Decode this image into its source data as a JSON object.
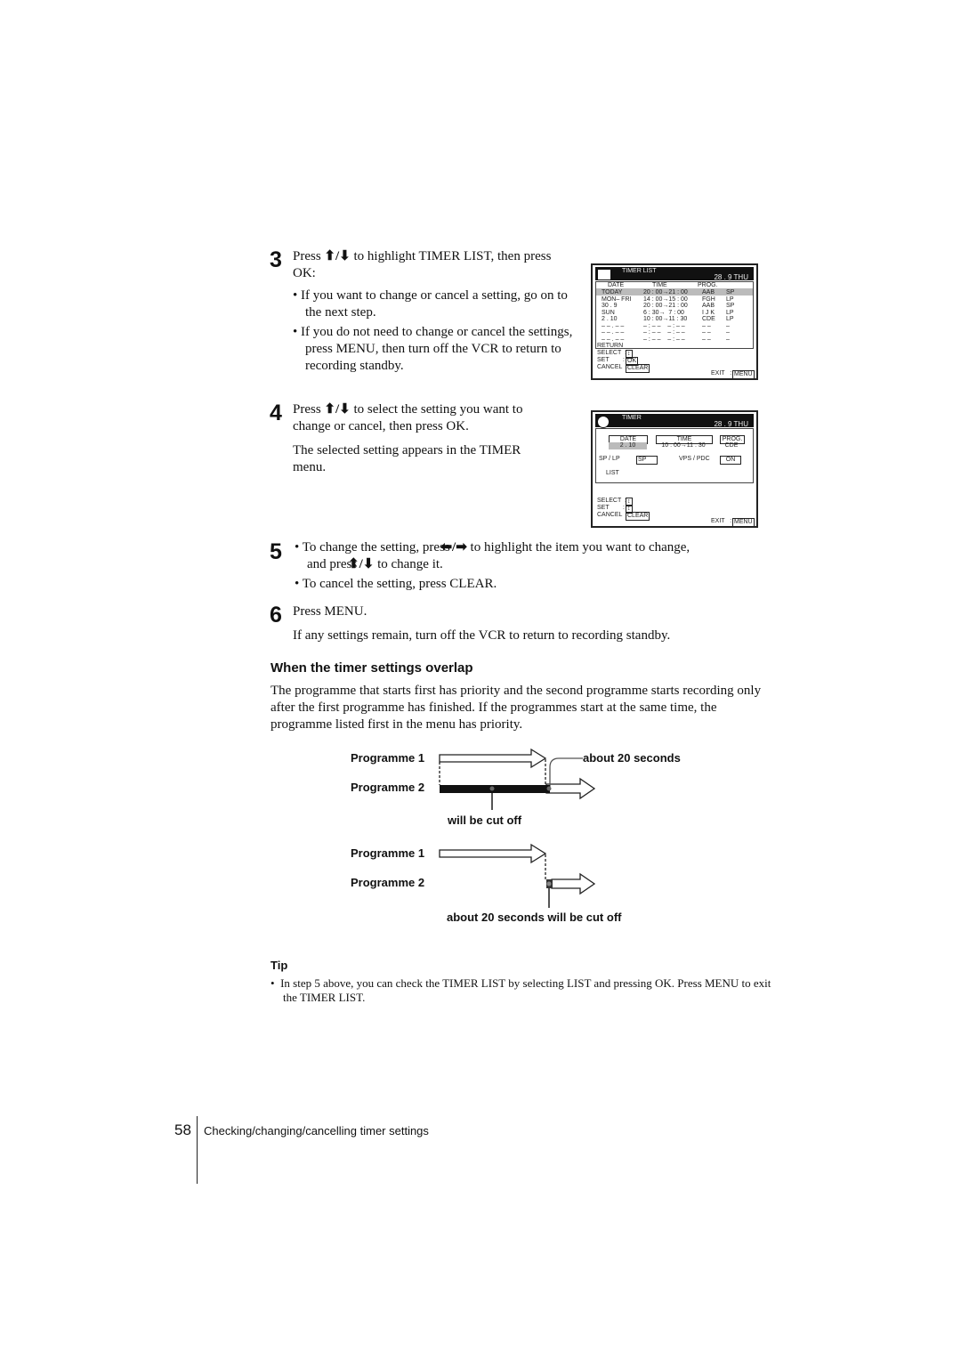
{
  "steps": [
    {
      "num": "3",
      "line1_pre": "Press",
      "line1_post": "to highlight TIMER LIST, then press",
      "line2": "OK:",
      "bullets": [
        "If you want to change or cancel a setting, go on to the next step.",
        "If you do not need to change or cancel the settings, press MENU, then turn off the VCR to return to recording standby."
      ]
    },
    {
      "num": "4",
      "line1_pre": "Press",
      "line1_post": "to select the setting you want to",
      "line2": "change or cancel, then press OK.",
      "para": "The selected setting appears in the TIMER menu."
    },
    {
      "num": "5",
      "b1_pre": "To change the setting, press",
      "b1_post": "to highlight the item you want to change,",
      "b1_line2_pre": "and press",
      "b1_line2_post": "to change it.",
      "b2": "To cancel the setting, press CLEAR."
    },
    {
      "num": "6",
      "line1": "Press MENU.",
      "para": "If any settings remain, turn off the VCR to return to recording standby."
    }
  ],
  "icons": {
    "up_down": "up-down-arrows-icon",
    "left_right": "left-right-arrows-icon"
  },
  "timer_list": {
    "title": "TIMER LIST",
    "date": "28 . 9  THU",
    "headers": [
      "DATE",
      "TIME",
      "PROG."
    ],
    "rows": [
      [
        "TODAY",
        "20 : 00→21 : 00",
        "AAB",
        "SP"
      ],
      [
        "MON– FRI",
        "14 : 00→15 : 00",
        "FGH",
        "LP"
      ],
      [
        "30 . 9",
        "20 : 00→21 : 00",
        "AAB",
        "SP"
      ],
      [
        "SUN",
        "6 : 30→  7 : 00",
        "I J K",
        "LP"
      ],
      [
        "2 . 10",
        "10 : 00→11 : 30",
        "CDE",
        "LP"
      ],
      [
        "– – . – –",
        "– : – –    – : – –",
        "– –",
        "–"
      ],
      [
        "– – . – –",
        "– : – –    – : – –",
        "– –",
        "–"
      ],
      [
        "– – . – –",
        "– : – –    – : – –",
        "– –",
        "–"
      ]
    ],
    "return": "RETURN",
    "select": "SELECT  :",
    "select_key": "↕",
    "set": "SET        :",
    "set_key": "OK",
    "cancel": "CANCEL  :",
    "cancel_key": "CLEAR",
    "exit": "EXIT   :",
    "exit_key": "MENU"
  },
  "timer": {
    "title": "TIMER",
    "date": "28 . 9  THU",
    "headers": [
      "DATE",
      "TIME",
      "PROG."
    ],
    "values": [
      "2 . 10",
      "10 : 00→11 : 30",
      "CDE"
    ],
    "splp_label": "SP / LP",
    "splp_value": "SP",
    "vps_label": "VPS / PDC",
    "vps_value": "ON",
    "list": "LIST",
    "select": "SELECT  :",
    "select_key": "↕",
    "set": "SET        :",
    "set_key": "↕",
    "cancel": "CANCEL  :",
    "cancel_key": "CLEAR",
    "exit": "EXIT   :",
    "exit_key": "MENU"
  },
  "overlap": {
    "heading": "When the timer settings overlap",
    "para": "The programme that starts first has priority and the second programme starts recording only after the first programme has finished.  If the programmes start at the same time, the programme listed first in the menu has priority.",
    "diagram1": {
      "p1": "Programme 1",
      "p2": "Programme 2",
      "note_right": "about 20 seconds",
      "note_below": "will be cut off"
    },
    "diagram2": {
      "p1": "Programme 1",
      "p2": "Programme 2",
      "note_below": "about 20 seconds will be cut off"
    }
  },
  "tip": {
    "label": "Tip",
    "text": "In step 5 above, you can check the TIMER LIST by selecting LIST and pressing OK. Press MENU to exit the TIMER LIST."
  },
  "footer": {
    "page": "58",
    "section": "Checking/changing/cancelling timer settings"
  }
}
